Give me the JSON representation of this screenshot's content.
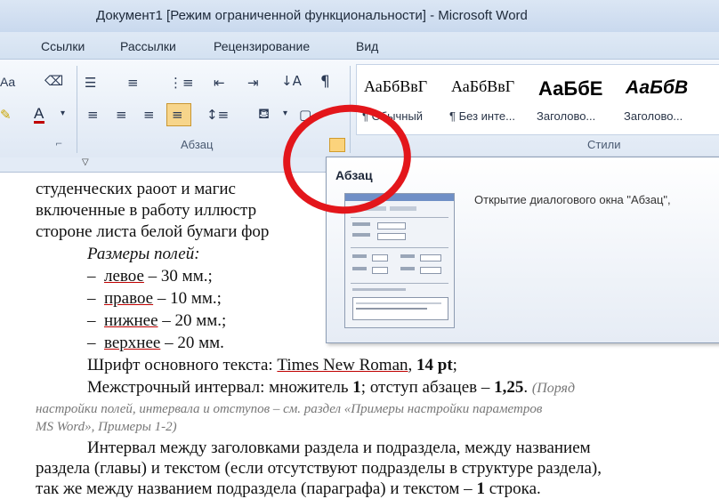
{
  "window": {
    "title": "Документ1 [Режим ограниченной функциональности]  -  Microsoft Word"
  },
  "tabs": [
    "Ссылки",
    "Рассылки",
    "Рецензирование",
    "Вид"
  ],
  "ribbon": {
    "groups": {
      "paragraph": "Абзац",
      "styles": "Стили"
    },
    "font_partial": "Aa",
    "styles": [
      {
        "sample": "АаБбВвГ",
        "name": "¶ Обычный"
      },
      {
        "sample": "АаБбВвГ",
        "name": "¶ Без инте..."
      },
      {
        "sample": "АаБбЕ",
        "name": "Заголово..."
      },
      {
        "sample": "АаБбВ",
        "name": "Заголово..."
      }
    ],
    "icons": [
      "bullets-icon",
      "numbering-icon",
      "multilevel-list-icon",
      "decrease-indent-icon",
      "increase-indent-icon",
      "sort-icon",
      "show-marks-icon",
      "align-left-icon",
      "align-center-icon",
      "align-right-icon",
      "justify-icon",
      "line-spacing-icon",
      "shading-icon",
      "borders-icon",
      "paragraph-dialog-launcher-icon"
    ],
    "highlight_color": "#c00000",
    "accent_color": "#e3161b"
  },
  "tooltip": {
    "title": "Абзац",
    "description": "Открытие диалогового окна \"Абзац\","
  },
  "document": {
    "line1": "студенческих  раоот  и  магис",
    "line2": "включенные в работу иллюстр",
    "line3": "стороне листа белой бумаги фор",
    "margins_heading": "Размеры полей:",
    "margins": [
      {
        "name": "левое",
        "value": "– 30 мм.;"
      },
      {
        "name": "правое",
        "value": "– 10 мм.;"
      },
      {
        "name": "нижнее",
        "value": "– 20 мм.;"
      },
      {
        "name": "верхнее",
        "value": "– 20 мм."
      }
    ],
    "font_label": "Шрифт основного текста:",
    "font_name": "Times New Roman",
    "font_size": "14 pt",
    "spacing_label": "Межстрочный интервал: множитель",
    "spacing_value": "1",
    "indent_label": "; отступ абзацев –",
    "indent_value": "1,25",
    "note1": "(Поряд",
    "note2": "настройки полей, интервала и отступов – см. раздел «Примеры настройки параметров",
    "note3": "MS Word», Примеры 1-2)",
    "para1": "Интервал между заголовками раздела и подраздела, между названием",
    "para2": "раздела (главы) и текстом (если отсутствуют подразделы в структуре раздела),",
    "para3_a": "так же между названием подраздела (параграфа) и текстом –",
    "para3_b": "1",
    "para3_c": "строка."
  }
}
